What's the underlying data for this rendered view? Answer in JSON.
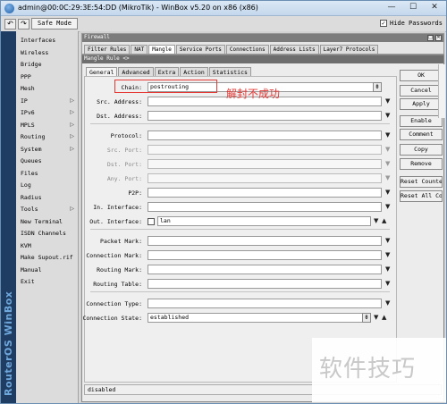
{
  "window": {
    "title": "admin@00:0C:29:3E:54:DD (MikroTik) - WinBox v5.20 on x86 (x86)",
    "minimize_glyph": "—",
    "maximize_glyph": "☐",
    "close_glyph": "✕"
  },
  "toolbar": {
    "undo_glyph": "↶",
    "redo_glyph": "↷",
    "safe_mode_label": "Safe Mode",
    "hide_passwords_label": "Hide Passwords",
    "hide_passwords_checked": true
  },
  "sideband": {
    "text": "RouterOS WinBox"
  },
  "menu": {
    "items": [
      {
        "label": "Interfaces",
        "submenu": false
      },
      {
        "label": "Wireless",
        "submenu": false
      },
      {
        "label": "Bridge",
        "submenu": false
      },
      {
        "label": "PPP",
        "submenu": false
      },
      {
        "label": "Mesh",
        "submenu": false
      },
      {
        "label": "IP",
        "submenu": true
      },
      {
        "label": "IPv6",
        "submenu": true
      },
      {
        "label": "MPLS",
        "submenu": true
      },
      {
        "label": "Routing",
        "submenu": true
      },
      {
        "label": "System",
        "submenu": true
      },
      {
        "label": "Queues",
        "submenu": false
      },
      {
        "label": "Files",
        "submenu": false
      },
      {
        "label": "Log",
        "submenu": false
      },
      {
        "label": "Radius",
        "submenu": false
      },
      {
        "label": "Tools",
        "submenu": true
      },
      {
        "label": "New Terminal",
        "submenu": false
      },
      {
        "label": "ISDN Channels",
        "submenu": false
      },
      {
        "label": "KVM",
        "submenu": false
      },
      {
        "label": "Make Supout.rif",
        "submenu": false
      },
      {
        "label": "Manual",
        "submenu": false
      },
      {
        "label": "Exit",
        "submenu": false
      }
    ],
    "submenu_glyph": "▷"
  },
  "firewall": {
    "title": "Firewall",
    "tabs": [
      "Filter Rules",
      "NAT",
      "Mangle",
      "Service Ports",
      "Connections",
      "Address Lists",
      "Layer7 Protocols"
    ],
    "active_tab": "Mangle"
  },
  "rule_window": {
    "title": "Mangle Rule <>",
    "tabs": [
      "General",
      "Advanced",
      "Extra",
      "Action",
      "Statistics"
    ],
    "active_tab": "General",
    "fields": {
      "chain": {
        "label": "Chain:",
        "value": "postrouting"
      },
      "src_address": {
        "label": "Src. Address:",
        "value": ""
      },
      "dst_address": {
        "label": "Dst. Address:",
        "value": ""
      },
      "protocol": {
        "label": "Protocol:",
        "value": ""
      },
      "src_port": {
        "label": "Src. Port:",
        "value": ""
      },
      "dst_port": {
        "label": "Dst. Port:",
        "value": ""
      },
      "any_port": {
        "label": "Any. Port:",
        "value": ""
      },
      "p2p": {
        "label": "P2P:",
        "value": ""
      },
      "in_interface": {
        "label": "In. Interface:",
        "value": ""
      },
      "out_interface": {
        "label": "Out. Interface:",
        "value": "lan"
      },
      "packet_mark": {
        "label": "Packet Mark:",
        "value": ""
      },
      "connection_mark": {
        "label": "Connection Mark:",
        "value": ""
      },
      "routing_mark": {
        "label": "Routing Mark:",
        "value": ""
      },
      "routing_table": {
        "label": "Routing Table:",
        "value": ""
      },
      "connection_type": {
        "label": "Connection Type:",
        "value": ""
      },
      "connection_state": {
        "label": "Connection State:",
        "value": "established"
      }
    },
    "buttons": [
      "OK",
      "Cancel",
      "Apply",
      "Enable",
      "Comment",
      "Copy",
      "Remove",
      "Reset Counters",
      "Reset All Counters"
    ],
    "status": "disabled"
  },
  "annotation": {
    "text": "解封不成功",
    "color": "#e53935"
  },
  "watermark": {
    "text": "软件技巧"
  }
}
